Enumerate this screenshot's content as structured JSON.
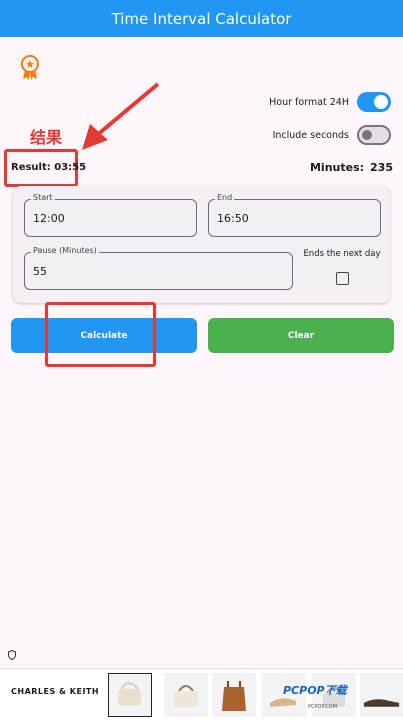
{
  "app": {
    "title": "Time Interval Calculator"
  },
  "annotation": {
    "label": "结果"
  },
  "settings": {
    "hour_format_label": "Hour format 24H",
    "hour_format_on": true,
    "include_seconds_label": "Include seconds",
    "include_seconds_on": false
  },
  "result": {
    "text": "Result: 03:55"
  },
  "minutes": {
    "label": "Minutes:",
    "value": "235"
  },
  "form": {
    "start_label": "Start",
    "start_value": "12:00",
    "end_label": "End",
    "end_value": "16:50",
    "pause_label": "Pause (Minutes)",
    "pause_value": "55",
    "next_day_label": "Ends the next day",
    "next_day_checked": false
  },
  "buttons": {
    "calculate": "Calculate",
    "clear": "Clear"
  },
  "ad": {
    "brand": "CHARLES & KEITH"
  },
  "watermark": {
    "text": "PCPOP下载",
    "sub": "PCPOP.COM"
  },
  "colors": {
    "primary": "#2196f3",
    "clear": "#4caf50",
    "annotation": "#e53935",
    "badge": "#f57c00"
  }
}
